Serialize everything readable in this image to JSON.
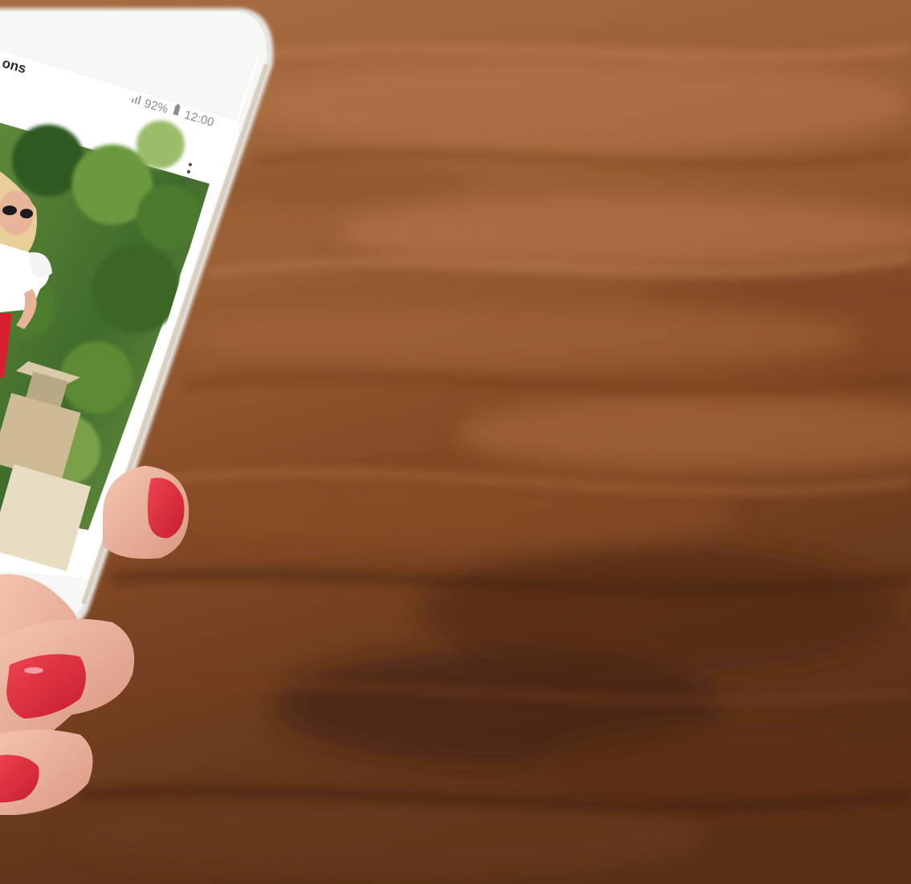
{
  "phone": {
    "app_title": "ons",
    "status": {
      "battery": "92%",
      "time": "12:00"
    },
    "menu_icon": "more-vert-icon"
  },
  "colors": {
    "wood_light": "#b07244",
    "wood_dark": "#4a2912",
    "nail_red": "#e02b3a",
    "skin": "#f0b7a0",
    "phone_white": "#f4f4f2"
  }
}
